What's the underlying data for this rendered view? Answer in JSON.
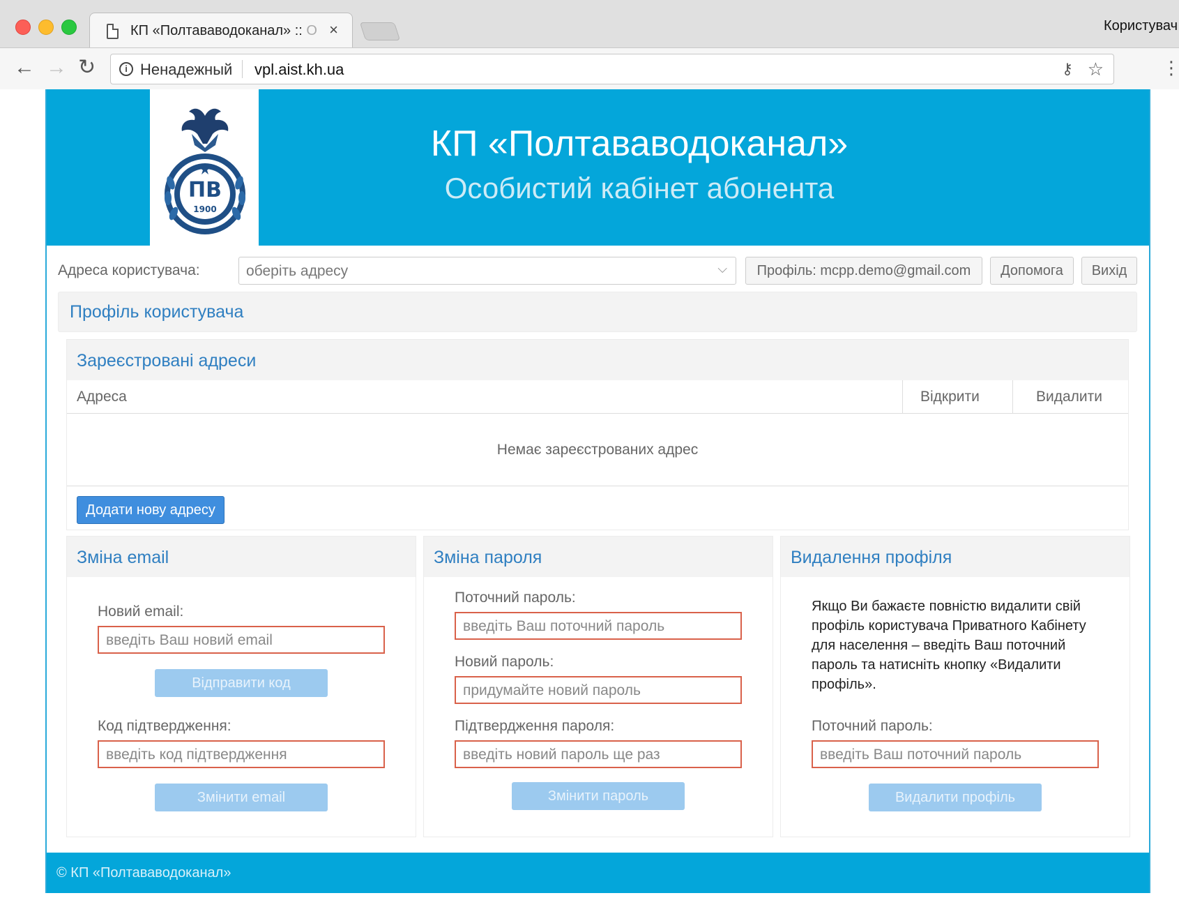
{
  "browser": {
    "tab_title": "КП «Полтававодоканал» :: ",
    "tab_title_fade": "О",
    "tab_close": "×",
    "user_label": "Користувач",
    "insecure_label": "Ненадежный",
    "url": "vpl.aist.kh.ua",
    "icons": {
      "back": "←",
      "forward": "→",
      "reload": "↻",
      "info": "i",
      "key": "⚷",
      "star": "☆",
      "menu": "⋮"
    }
  },
  "header": {
    "title": "КП «Полтававодоканал»",
    "subtitle": "Особистий кабінет абонента",
    "logo_text": "ПВ",
    "logo_year": "1900"
  },
  "address_bar": {
    "label": "Адреса користувача:",
    "select_value": "оберіть адресу",
    "select_chevron": "⌵",
    "profile_button": "Профіль: mcpp.demo@gmail.com",
    "help_button": "Допомога",
    "exit_button": "Вихід"
  },
  "profile": {
    "title": "Профіль користувача"
  },
  "registered": {
    "title": "Зареєстровані адреси",
    "columns": [
      "Адреса",
      "Відкрити",
      "Видалити"
    ],
    "empty": "Немає зареєстрованих адрес",
    "add_button": "Додати нову адресу"
  },
  "change_email": {
    "title": "Зміна email",
    "new_email_label": "Новий email:",
    "new_email_placeholder": "введіть Ваш новий email",
    "send_code_button": "Відправити код",
    "code_label": "Код підтвердження:",
    "code_placeholder": "введіть код підтвердження",
    "submit_button": "Змінити email"
  },
  "change_password": {
    "title": "Зміна пароля",
    "current_label": "Поточний пароль:",
    "current_placeholder": "введіть Ваш поточний пароль",
    "new_label": "Новий пароль:",
    "new_placeholder": "придумайте новий пароль",
    "confirm_label": "Підтвердження пароля:",
    "confirm_placeholder": "введіть новий пароль ще раз",
    "submit_button": "Змінити пароль"
  },
  "delete_profile": {
    "title": "Видалення профіля",
    "description": "Якщо Ви бажаєте повністю видалити свій профіль користувача Приватного Кабінету для населення – введіть Ваш поточний пароль та натисніть кнопку «Видалити профіль».",
    "current_label": "Поточний пароль:",
    "current_placeholder": "введіть Ваш поточний пароль",
    "submit_button": "Видалити профіль"
  },
  "footer": {
    "text": "© КП «Полтававодоканал»"
  },
  "colors": {
    "brand": "#04a6da",
    "link": "#2f7fc1",
    "primary_button": "#3f8ede",
    "disabled_button": "#9ccaef",
    "input_error_border": "#d9614a"
  }
}
